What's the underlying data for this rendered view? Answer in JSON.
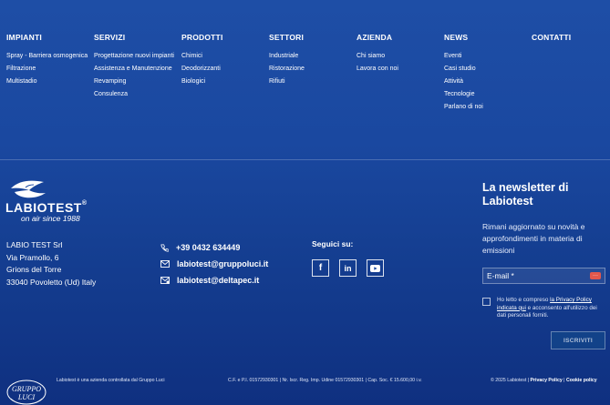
{
  "nav": {
    "columns": [
      {
        "title": "IMPIANTI",
        "items": [
          "Spray - Barriera osmogenica",
          "Filtrazione",
          "Multistadio"
        ]
      },
      {
        "title": "SERVIZI",
        "items": [
          "Progettazione nuovi impianti",
          "Assistenza e Manutenzione",
          "Revamping",
          "Consulenza"
        ]
      },
      {
        "title": "PRODOTTI",
        "items": [
          "Chimici",
          "Deodorizzanti",
          "Biologici"
        ]
      },
      {
        "title": "SETTORI",
        "items": [
          "Industriale",
          "Ristorazione",
          "Rifiuti"
        ]
      },
      {
        "title": "AZIENDA",
        "items": [
          "Chi siamo",
          "Lavora con noi"
        ]
      },
      {
        "title": "NEWS",
        "items": [
          "Eventi",
          "Casi studio",
          "Attività",
          "Tecnologie",
          "Parlano di noi"
        ]
      },
      {
        "title": "CONTATTI",
        "items": []
      }
    ]
  },
  "brand": {
    "name": "LABIOTEST",
    "registered": "®",
    "tagline": "on air since 1988"
  },
  "address": {
    "line1": "LABIO TEST Srl",
    "line2": "Via Pramollo, 6",
    "line3": "Grions del Torre",
    "line4": "33040 Povoletto (Ud) Italy"
  },
  "contacts": {
    "phone": "+39 0432 634449",
    "email": "labiotest@gruppoluci.it",
    "pec": "labiotest@deltapec.it"
  },
  "social": {
    "title": "Seguici su:",
    "facebook": "f",
    "linkedin": "in"
  },
  "newsletter": {
    "title": "La newsletter di Labiotest",
    "description": "Rimani aggiornato su novità e approfondimenti in materia di emissioni",
    "email_placeholder": "E-mail *",
    "consent_prefix": "Ho letto e compreso ",
    "consent_link": "la Privacy Policy indicata qui",
    "consent_suffix": " e acconsento all'utilizzo dei dati personali forniti.",
    "submit_label": "ISCRIVITI"
  },
  "footer": {
    "gruppo_line1": "GRUPPO",
    "gruppo_line2": "LUCI",
    "company_note": "Labiotest è una azienda controllata dal Gruppo Luci",
    "legal": "C.F. e P.I. 01572930301 | Nr. Iscr. Reg. Imp. Udine 01572930301 | Cap. Soc. € 15.600,00 i.v.",
    "copyright": "© 2025 Labiotest | ",
    "privacy_link": "Privacy Policy",
    "separator": " | ",
    "cookie_link": "Cookie policy"
  },
  "colors": {
    "background": "#1a48a0",
    "error_badge": "#e3584d"
  }
}
